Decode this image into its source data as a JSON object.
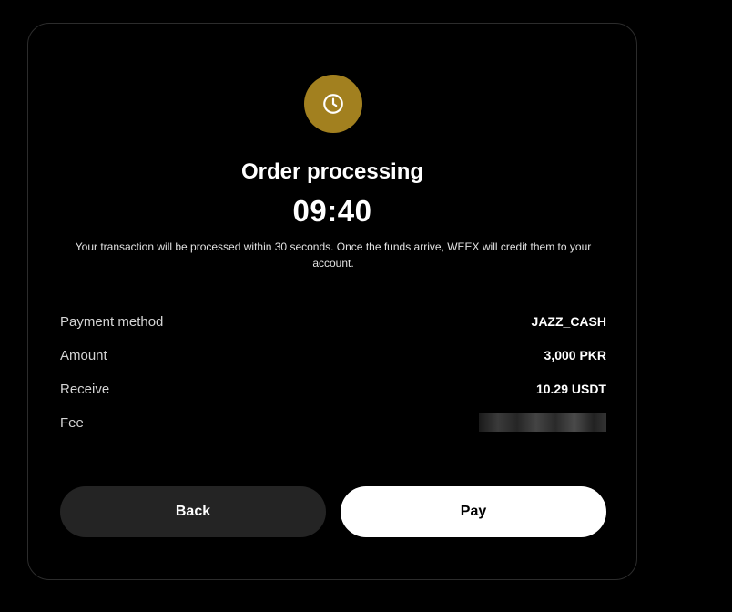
{
  "order": {
    "icon": "clock-icon",
    "title": "Order processing",
    "countdown": "09:40",
    "description": "Your transaction will be processed within 30 seconds. Once the funds arrive, WEEX will credit them to your account."
  },
  "details": {
    "payment_method": {
      "label": "Payment method",
      "value": "JAZZ_CASH"
    },
    "amount": {
      "label": "Amount",
      "value": "3,000 PKR"
    },
    "receive": {
      "label": "Receive",
      "value": "10.29 USDT"
    },
    "fee": {
      "label": "Fee",
      "value_redacted": true
    }
  },
  "actions": {
    "back_label": "Back",
    "pay_label": "Pay"
  },
  "colors": {
    "accent": "#a2801f",
    "background": "#000000",
    "secondary_button": "#242424",
    "primary_button": "#ffffff"
  }
}
